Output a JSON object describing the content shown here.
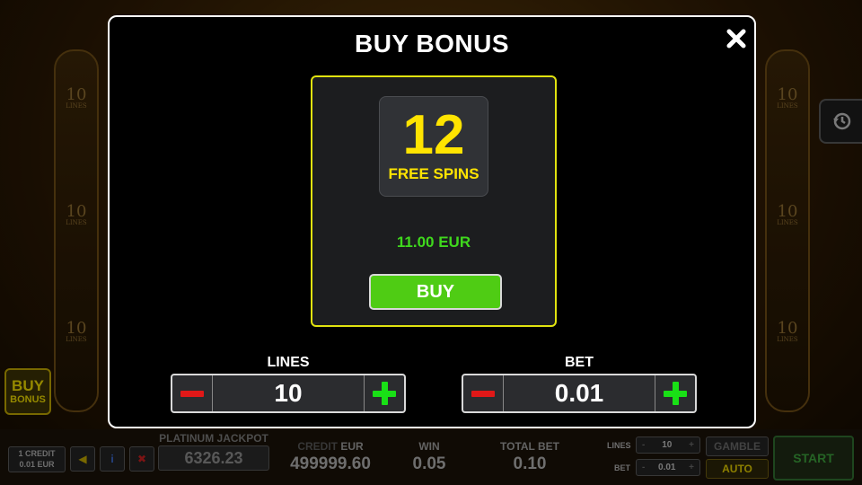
{
  "modal": {
    "title": "BUY BONUS",
    "close_icon": "close-icon",
    "offer": {
      "spins_count": "12",
      "spins_label": "FREE SPINS",
      "price": "11.00 EUR",
      "buy_label": "BUY"
    },
    "lines": {
      "label": "LINES",
      "value": "10"
    },
    "bet": {
      "label": "BET",
      "value": "0.01"
    }
  },
  "side": {
    "lines_marks": [
      {
        "number": "10",
        "text": "LINES"
      },
      {
        "number": "10",
        "text": "LINES"
      },
      {
        "number": "10",
        "text": "LINES"
      }
    ],
    "buy_bonus": {
      "line1": "BUY",
      "line2": "BONUS"
    },
    "history_icon": "history-icon"
  },
  "bottom": {
    "credit_info": {
      "line1": "1 CREDIT",
      "line2": "0.01 EUR"
    },
    "jackpot": {
      "label": "PLATINUM JACKPOT",
      "value": "6326.23"
    },
    "credit": {
      "label_dim": "CREDIT",
      "label": "EUR",
      "value": "499999.60"
    },
    "win": {
      "label": "WIN",
      "value": "0.05"
    },
    "total_bet": {
      "label": "TOTAL BET",
      "value": "0.10"
    },
    "lines": {
      "label": "LINES",
      "value": "10"
    },
    "bet": {
      "label": "BET",
      "value": "0.01"
    },
    "gamble_label": "GAMBLE",
    "auto_label": "AUTO",
    "start_label": "START"
  },
  "colors": {
    "accent_yellow": "#ffe400",
    "price_green": "#3fd81d",
    "buy_green": "#4fcc14",
    "minus_red": "#e01818",
    "plus_green": "#19e016"
  }
}
